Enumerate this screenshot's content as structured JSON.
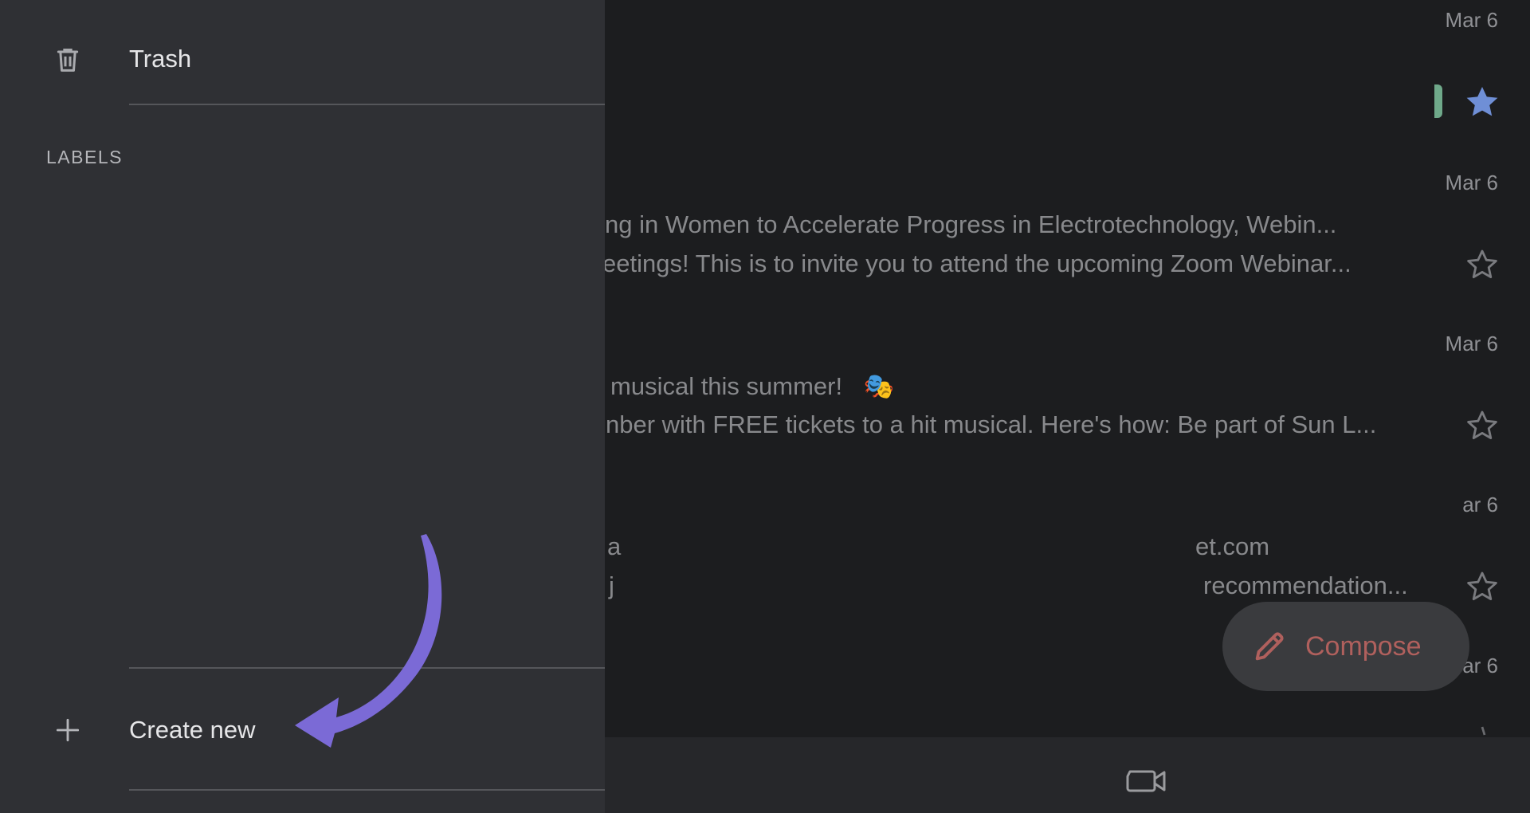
{
  "drawer": {
    "trash": {
      "label": "Trash",
      "icon": "trash-icon"
    },
    "labels_heading": "LABELS",
    "create_new": {
      "label": "Create new",
      "icon": "plus-icon"
    }
  },
  "inbox": {
    "rows": [
      {
        "date": "Mar 6",
        "starred": false
      },
      {
        "date": "",
        "starred": true,
        "label_chip_color": "#6fa98a"
      },
      {
        "date": "Mar 6",
        "subject": "sting in Women to Accelerate Progress in Electrotechnology, Webin...",
        "snippet": "eetings! This is to invite you to attend the upcoming Zoom Webinar...",
        "starred": false
      },
      {
        "date": "Mar 6",
        "subject": "musical this summer!",
        "subject_emoji": "🎭",
        "snippet": "nber with FREE tickets to a hit musical. Here's how: Be part of Sun L...",
        "starred": false
      },
      {
        "date": "ar 6",
        "subject_left": "a",
        "subject_right": "et.com",
        "snippet_left": "j",
        "snippet_right": "recommendation...",
        "starred": false
      },
      {
        "date": "ar 6"
      }
    ]
  },
  "compose": {
    "label": "Compose",
    "icon": "pencil-icon",
    "color": "#b0605d"
  },
  "bottom_nav": {
    "icon": "video-camera-icon"
  },
  "annotation": {
    "icon": "curved-arrow-icon",
    "color": "#7b6ad6"
  },
  "colors": {
    "drawer_bg": "#2f3034",
    "inbox_bg": "#1c1d1f",
    "star_filled": "#6f8fd6"
  }
}
